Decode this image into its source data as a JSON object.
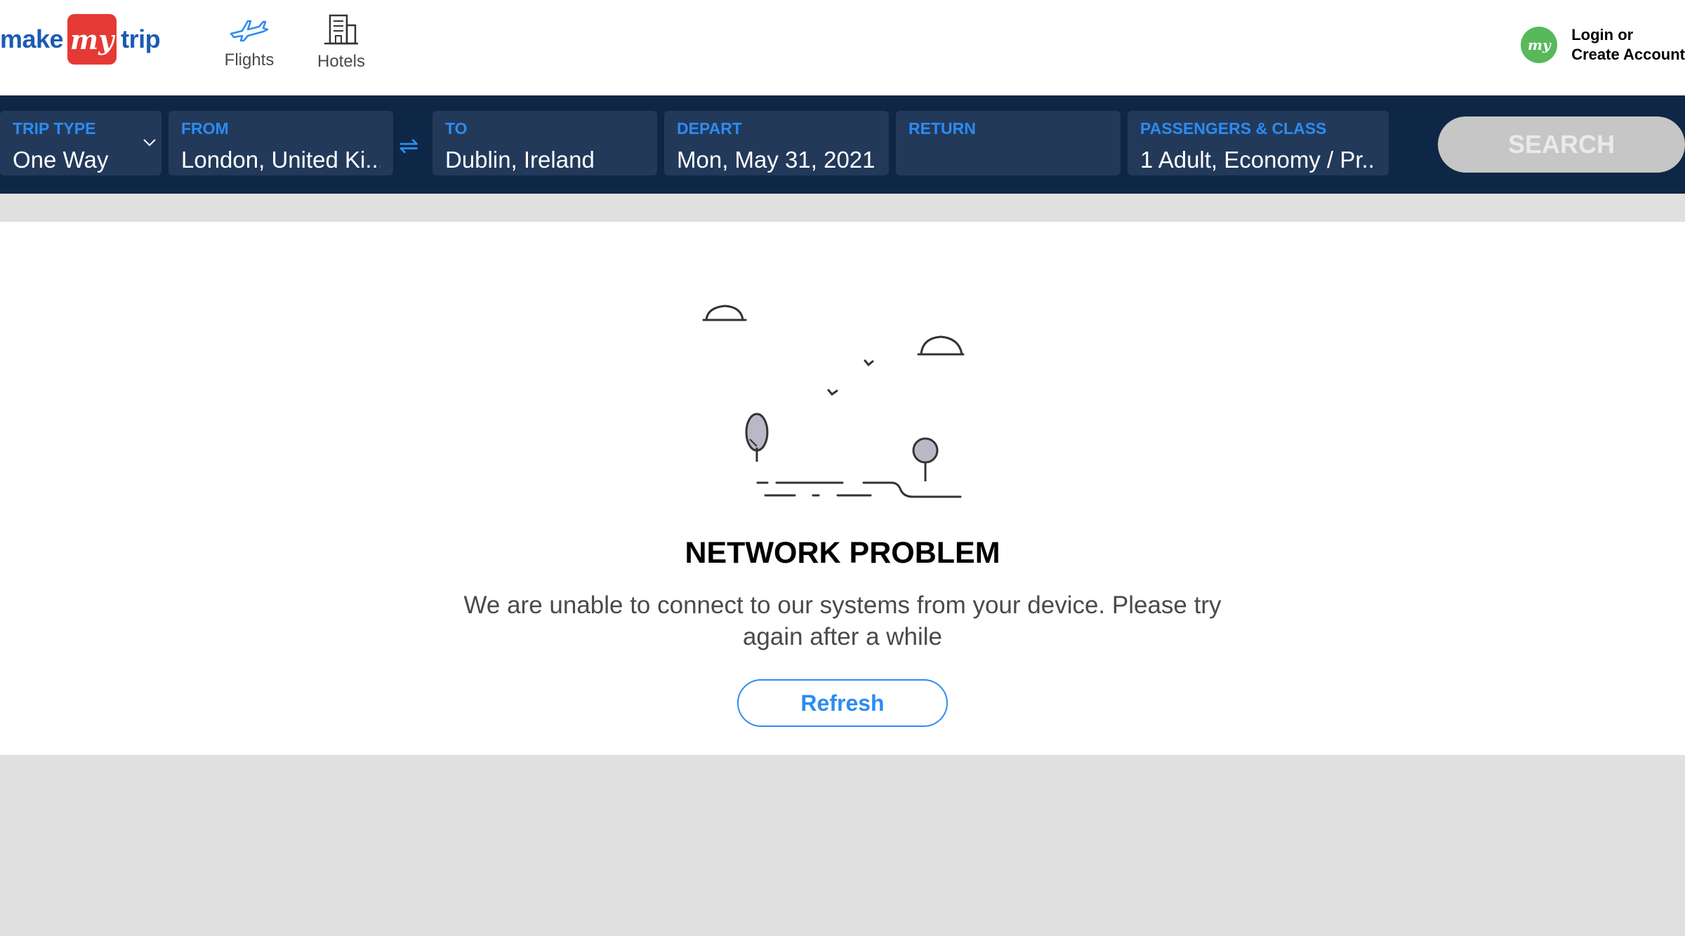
{
  "header": {
    "logo": {
      "make": "make",
      "my": "my",
      "trip": "trip"
    },
    "nav": [
      {
        "label": "Flights",
        "icon": "plane-icon"
      },
      {
        "label": "Hotels",
        "icon": "building-icon"
      }
    ],
    "login": {
      "line1": "Login or",
      "line2": "Create Account",
      "avatar_text": "my"
    }
  },
  "search": {
    "trip_type": {
      "label": "TRIP TYPE",
      "value": "One Way"
    },
    "from": {
      "label": "FROM",
      "value": "London, United Ki..."
    },
    "swap_icon": "⇌",
    "to": {
      "label": "TO",
      "value": "Dublin, Ireland"
    },
    "depart": {
      "label": "DEPART",
      "value": "Mon, May 31, 2021"
    },
    "return": {
      "label": "RETURN",
      "value": ""
    },
    "passengers": {
      "label": "PASSENGERS & CLASS",
      "value": "1 Adult, Economy / Pr..."
    },
    "button": "SEARCH"
  },
  "error": {
    "title": "NETWORK PROBLEM",
    "message": "We are unable to connect to our systems from your device. Please try again after a while",
    "refresh": "Refresh"
  },
  "colors": {
    "brand_blue": "#1c5bb4",
    "brand_red": "#e53935",
    "navy": "#0f2746",
    "field_bg": "#23395a",
    "accent": "#2c8cf0",
    "disabled": "#c6c6c6"
  }
}
